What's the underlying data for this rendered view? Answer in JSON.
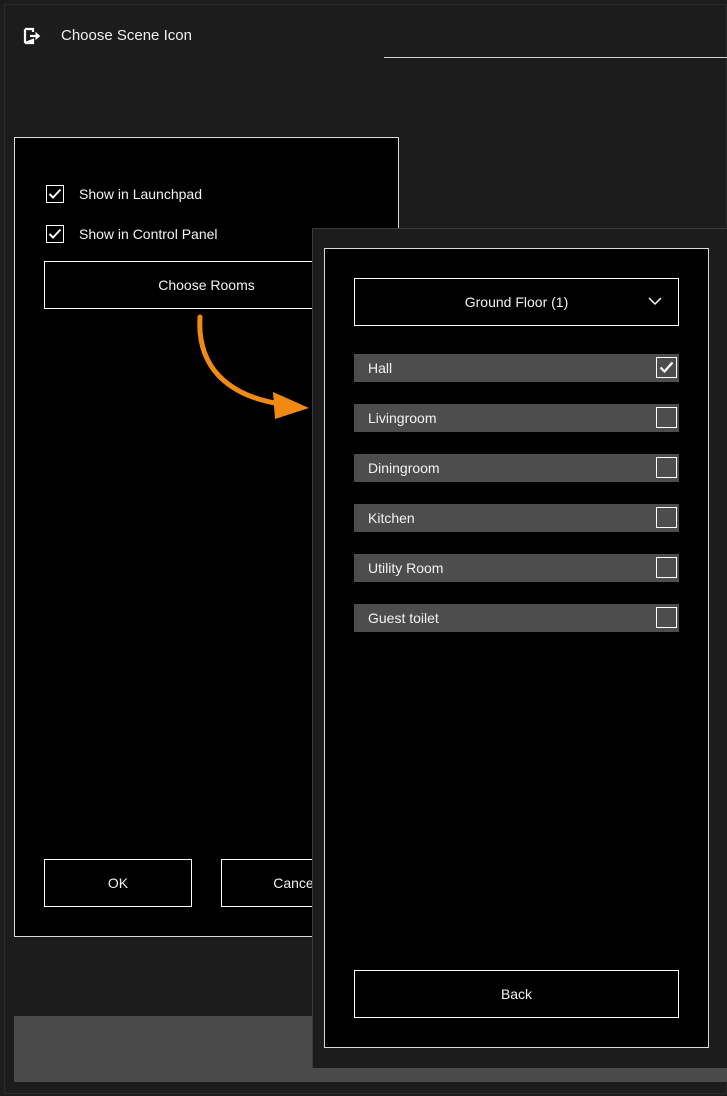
{
  "header": {
    "title": "Choose Scene Icon",
    "exit_icon": "exit-icon"
  },
  "left_panel": {
    "checkboxes": [
      {
        "label": "Show in Launchpad",
        "checked": true
      },
      {
        "label": "Show in Control Panel",
        "checked": true
      }
    ],
    "choose_rooms_label": "Choose Rooms",
    "ok_label": "OK",
    "cancel_label": "Cancel"
  },
  "annotation": {
    "arrow_color": "#f08a13",
    "arrow_icon": "curved-arrow-icon"
  },
  "rooms_panel": {
    "floor_selector": "Ground Floor (1)",
    "rooms": [
      {
        "label": "Hall",
        "checked": true
      },
      {
        "label": "Livingroom",
        "checked": false
      },
      {
        "label": "Diningroom",
        "checked": false
      },
      {
        "label": "Kitchen",
        "checked": false
      },
      {
        "label": "Utility Room",
        "checked": false
      },
      {
        "label": "Guest toilet",
        "checked": false
      }
    ],
    "back_label": "Back"
  },
  "colors": {
    "background": "#1c1c1c",
    "panel": "#000000",
    "row": "#4d4d4d",
    "bottom_bar": "#4a4a4a",
    "accent_arrow": "#f08a13"
  }
}
